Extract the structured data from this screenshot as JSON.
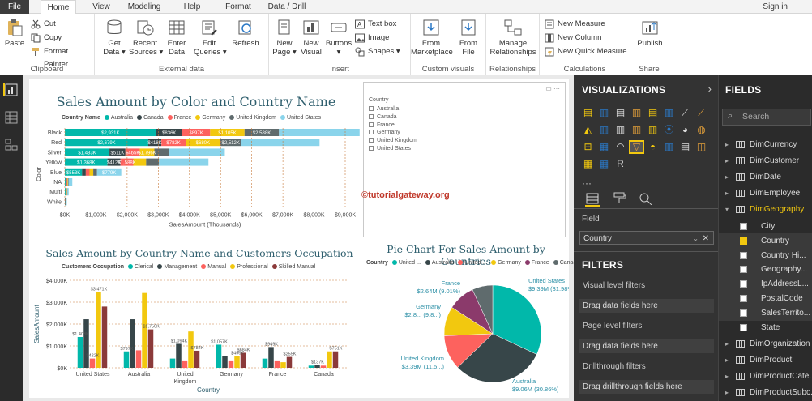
{
  "menu": {
    "file": "File",
    "tabs": [
      "Home",
      "View",
      "Modeling",
      "Help",
      "Format",
      "Data / Drill"
    ],
    "signin": "Sign in"
  },
  "ribbon": {
    "clipboard": {
      "label": "Clipboard",
      "paste": "Paste",
      "cut": "Cut",
      "copy": "Copy",
      "format_painter": "Format Painter"
    },
    "external": {
      "label": "External data",
      "get_data": "Get\nData ▾",
      "recent": "Recent\nSources ▾",
      "enter": "Enter\nData",
      "edit": "Edit\nQueries ▾",
      "refresh": "Refresh"
    },
    "insert": {
      "label": "Insert",
      "new_page": "New\nPage ▾",
      "new_visual": "New\nVisual",
      "buttons": "Buttons\n▾",
      "textbox": "Text box",
      "image": "Image",
      "shapes": "Shapes ▾"
    },
    "custom": {
      "label": "Custom visuals",
      "from_marketplace": "From\nMarketplace",
      "from_file": "From\nFile"
    },
    "relationships": {
      "label": "Relationships",
      "manage": "Manage\nRelationships"
    },
    "calculations": {
      "label": "Calculations",
      "new_measure": "New Measure",
      "new_column": "New Column",
      "new_quick_measure": "New Quick Measure"
    },
    "share": {
      "label": "Share",
      "publish": "Publish"
    }
  },
  "bar_chart": {
    "title": "Sales Amount by Color and Country Name",
    "legend_title": "Country Name",
    "legend": [
      "Australia",
      "Canada",
      "France",
      "Germany",
      "United Kingdom",
      "United States"
    ],
    "colors": [
      "#01b8aa",
      "#374649",
      "#fd625e",
      "#f2c80f",
      "#5f6b6d",
      "#8ad4eb"
    ],
    "ylabel": "Color",
    "xlabel": "SalesAmount (Thousands)",
    "xticks": [
      "$0K",
      "$1,000K",
      "$2,000K",
      "$3,000K",
      "$4,000K",
      "$5,000K",
      "$6,000K",
      "$7,000K",
      "$8,000K",
      "$9,000K"
    ]
  },
  "col_chart": {
    "title": "Sales Amount by Country Name and Customers Occupation",
    "legend_title": "Customers Occupation",
    "legend": [
      "Clerical",
      "Management",
      "Manual",
      "Professional",
      "Skilled Manual"
    ],
    "yticks": [
      "$0K",
      "$1,000K",
      "$2,000K",
      "$3,000K",
      "$4,000K"
    ],
    "ylabel": "SalesAmount",
    "xlabel": "Country"
  },
  "pie_chart": {
    "title": "Pie Chart For Sales Amount by Countries",
    "legend_title": "Country",
    "legend": [
      "United ...",
      "Australia",
      "United ...",
      "Germany",
      "France",
      "Canada"
    ],
    "labels": {
      "us": [
        "United States",
        "$9.39M (31.98%)"
      ],
      "au": [
        "Australia",
        "$9.06M (30.86%)"
      ],
      "uk": [
        "United Kingdom",
        "$3.39M (11.5...)"
      ],
      "de": [
        "Germany",
        "$2.8... (9.8...)"
      ],
      "fr": [
        "France",
        "$2.64M (9.01%)"
      ]
    }
  },
  "slicer": {
    "title": "Country",
    "items": [
      "Australia",
      "Canada",
      "France",
      "Germany",
      "United Kingdom",
      "United States"
    ]
  },
  "watermark": "©tutorialgateway.org",
  "chart_data": [
    {
      "type": "bar",
      "title": "Sales Amount by Color and Country Name",
      "categories": [
        "Black",
        "Red",
        "Silver",
        "Yellow",
        "Blue",
        "NA",
        "Multi",
        "White"
      ],
      "series": [
        {
          "name": "Australia",
          "values": [
            2931,
            2679,
            1433,
            1368,
            553,
            35,
            25,
            10
          ]
        },
        {
          "name": "Canada",
          "values": [
            836,
            418,
            511,
            418,
            120,
            25,
            20,
            10
          ]
        },
        {
          "name": "France",
          "values": [
            897,
            782,
            465,
            412,
            120,
            20,
            15,
            8
          ]
        },
        {
          "name": "Germany",
          "values": [
            1105,
            1105,
            465,
            412,
            120,
            20,
            12,
            8
          ]
        },
        {
          "name": "United Kingdom",
          "values": [
            1105,
            680,
            465,
            412,
            120,
            20,
            12,
            8
          ]
        },
        {
          "name": "United States",
          "values": [
            2588,
            2512,
            1796,
            1588,
            779,
            120,
            40,
            20
          ]
        }
      ],
      "data_labels": {
        "Black": [
          "$2,931K",
          "$836K",
          "$897K",
          "$1,105K",
          "$2,588K"
        ],
        "Red": [
          "$2,679K",
          "$418K",
          "$782K",
          "$680K",
          "$2,512K"
        ],
        "Silver": [
          "$1,433K",
          "$511K",
          "$465K",
          "$1,796K"
        ],
        "Yellow": [
          "$1,368K",
          "$412K",
          "$1,588K"
        ],
        "Blue": [
          "$553K",
          "$779K"
        ]
      },
      "xlabel": "SalesAmount (Thousands)",
      "ylabel": "Color",
      "xlim": [
        0,
        9000
      ],
      "legend": "top"
    },
    {
      "type": "bar",
      "title": "Sales Amount by Country Name and Customers Occupation",
      "categories": [
        "United States",
        "Australia",
        "United Kingdom",
        "Germany",
        "France",
        "Canada"
      ],
      "series": [
        {
          "name": "Clerical",
          "values": [
            1408,
            750,
            422,
            1057,
            420,
            100
          ]
        },
        {
          "name": "Management",
          "values": [
            2220,
            2220,
            1094,
            540,
            949,
            137
          ]
        },
        {
          "name": "Manual",
          "values": [
            422,
            800,
            300,
            300,
            300,
            100
          ]
        },
        {
          "name": "Professional",
          "values": [
            3471,
            3420,
            1660,
            540,
            255,
            751
          ]
        },
        {
          "name": "Skilled Manual",
          "values": [
            2800,
            1756,
            780,
            686,
            496,
            751
          ]
        }
      ],
      "data_labels": [
        "$1.408K",
        "$3,471K",
        "$797K",
        "$1,756K",
        "$1,094K",
        "$784K",
        "$1,057K",
        "$684K",
        "$496K",
        "$949K",
        "$255K",
        "$137K",
        "$751K",
        "$422K"
      ],
      "xlabel": "Country",
      "ylabel": "SalesAmount",
      "ylim": [
        0,
        4000
      ],
      "legend": "top"
    },
    {
      "type": "pie",
      "title": "Pie Chart For Sales Amount by Countries",
      "labels": [
        "United States",
        "Australia",
        "United Kingdom",
        "Germany",
        "France",
        "Canada"
      ],
      "values": [
        31.98,
        30.86,
        11.5,
        9.8,
        9.01,
        6.85
      ],
      "colors": [
        "#01b8aa",
        "#374649",
        "#fd625e",
        "#f2c80f",
        "#8b3a6b",
        "#5f6b6d"
      ],
      "legend": "top"
    }
  ],
  "viz": {
    "header": "VISUALIZATIONS",
    "field_label": "Field",
    "field_value": "Country",
    "filters": "FILTERS",
    "visual_filters": "Visual level filters",
    "drag1": "Drag data fields here",
    "page_filters": "Page level filters",
    "drag2": "Drag data fields here",
    "drill": "Drillthrough filters",
    "drag3": "Drag drillthrough fields here"
  },
  "fields": {
    "header": "FIELDS",
    "search": "Search",
    "tables": [
      "DimCurrency",
      "DimCustomer",
      "DimDate",
      "DimEmployee",
      "DimGeography"
    ],
    "columns": [
      "City",
      "Country",
      "Country Hi...",
      "Geography...",
      "IpAddressL...",
      "PostalCode",
      "SalesTerrito...",
      "State"
    ],
    "tables2": [
      "DimOrganization",
      "DimProduct",
      "DimProductCate...",
      "DimProductSubc..."
    ]
  }
}
